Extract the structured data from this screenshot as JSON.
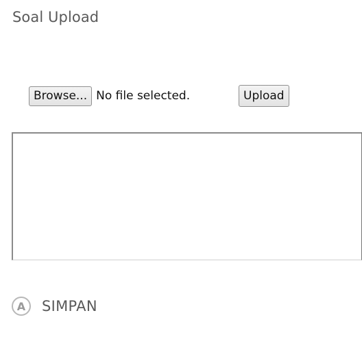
{
  "page": {
    "title": "Soal Upload"
  },
  "file_input": {
    "browse_label": "Browse...",
    "status": "No file selected."
  },
  "toolbar": {
    "upload_label": "Upload"
  },
  "editor": {
    "value": ""
  },
  "save": {
    "icon_glyph": "A",
    "icon_name": "circle-a-icon",
    "label": "SIMPAN"
  },
  "colors": {
    "title_text": "#5a5a5a",
    "button_border": "#8f8f8f",
    "field_border": "#8a8a8a",
    "icon_ring": "#b8b8b8"
  }
}
